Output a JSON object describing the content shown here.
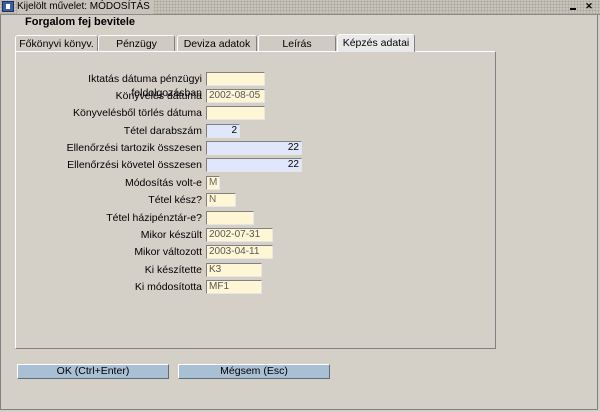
{
  "window": {
    "title": "Kijelölt művelet: MÓDOSÍTÁS"
  },
  "form": {
    "title": "Forgalom fej bevitele"
  },
  "tabs": [
    {
      "label": "Főkönyvi könyv."
    },
    {
      "label": "Pénzügy"
    },
    {
      "label": "Deviza adatok"
    },
    {
      "label": "Leírás"
    },
    {
      "label": "Képzés adatai",
      "active": true
    }
  ],
  "fields": [
    {
      "label": "Iktatás dátuma pénzügyi feldolgozásban",
      "value": ""
    },
    {
      "label": "Könyvelés dátuma",
      "value": "2002-08-05"
    },
    {
      "label": "Könyvelésből törlés dátuma",
      "value": ""
    },
    {
      "label": "Tétel darabszám",
      "value": "2"
    },
    {
      "label": "Ellenőrzési tartozik összesen",
      "value": "22"
    },
    {
      "label": "Ellenőrzési követel összesen",
      "value": "22"
    },
    {
      "label": "Módosítás volt-e",
      "value": "M"
    },
    {
      "label": "Tétel kész?",
      "value": "N"
    },
    {
      "label": "Tétel házipénztár-e?",
      "value": ""
    },
    {
      "label": "Mikor készült",
      "value": "2002-07-31"
    },
    {
      "label": "Mikor változott",
      "value": "2003-04-11"
    },
    {
      "label": "Ki készítette",
      "value": "K3"
    },
    {
      "label": "Ki módosította",
      "value": "MF1"
    }
  ],
  "buttons": {
    "ok": "OK (Ctrl+Enter)",
    "cancel": "Mégsem (Esc)"
  },
  "colors": {
    "field_yellow": "#fff6d6",
    "field_blue": "#e0e6fb",
    "button": "#a9bfd4"
  }
}
